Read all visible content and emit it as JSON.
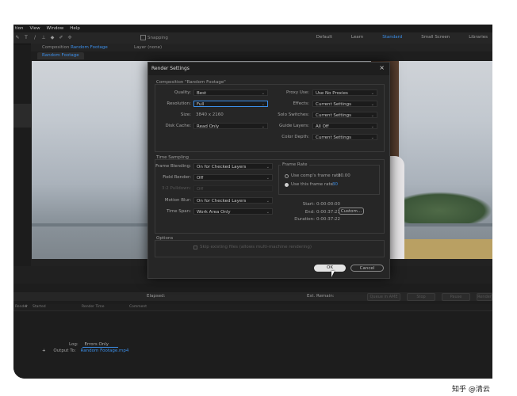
{
  "menubar": {
    "items": [
      "tion",
      "View",
      "Window",
      "Help"
    ]
  },
  "toolbar": {
    "snapping": "Snapping"
  },
  "workspaces": [
    "Default",
    "Learn",
    "Standard",
    "Small Screen",
    "Libraries"
  ],
  "panel": {
    "composition_prefix": "Composition",
    "composition_name": "Random Footage",
    "layer_label": "Layer (none)",
    "tab": "Random Footage"
  },
  "dialog": {
    "title": "Render Settings",
    "composition_group": "Composition \"Random Footage\"",
    "quality": {
      "label": "Quality:",
      "value": "Best"
    },
    "resolution": {
      "label": "Resolution:",
      "value": "Full"
    },
    "size": {
      "label": "Size:",
      "value": "3840 x 2160"
    },
    "disk_cache": {
      "label": "Disk Cache:",
      "value": "Read Only"
    },
    "proxy_use": {
      "label": "Proxy Use:",
      "value": "Use No Proxies"
    },
    "effects": {
      "label": "Effects:",
      "value": "Current Settings"
    },
    "solo_switches": {
      "label": "Solo Switches:",
      "value": "Current Settings"
    },
    "guide_layers": {
      "label": "Guide Layers:",
      "value": "All Off"
    },
    "color_depth": {
      "label": "Color Depth:",
      "value": "Current Settings"
    },
    "time_sampling": "Time Sampling",
    "frame_blending": {
      "label": "Frame Blending:",
      "value": "On for Checked Layers"
    },
    "field_render": {
      "label": "Field Render:",
      "value": "Off"
    },
    "pulldown": {
      "label": "3:2 Pulldown:",
      "value": "Off"
    },
    "motion_blur": {
      "label": "Motion Blur:",
      "value": "On for Checked Layers"
    },
    "time_span": {
      "label": "Time Span:",
      "value": "Work Area Only"
    },
    "frame_rate": {
      "title": "Frame Rate",
      "use_comp": "Use comp's frame rate",
      "comp_rate": "30.00",
      "use_this": "Use this frame rate:",
      "this_rate": "30"
    },
    "start": {
      "label": "Start:",
      "value": "0:00:00:00"
    },
    "end": {
      "label": "End:",
      "value": "0:00:37:21"
    },
    "duration": {
      "label": "Duration:",
      "value": "0:00:37:22"
    },
    "custom_label": "Custom...",
    "options": "Options",
    "options_checkbox": "Skip existing files (allows multi-machine rendering)",
    "ok": "OK",
    "cancel": "Cancel"
  },
  "render_queue": {
    "elapsed": "Elapsed:",
    "est_remain": "Est. Remain:",
    "queue_buttons": [
      "Queue in AME",
      "Stop",
      "Pause",
      "Render"
    ],
    "columns": [
      "Render",
      "#",
      "Started",
      "Render Time",
      "Comment"
    ],
    "log_label": "Log:",
    "log_value": "Errors Only",
    "output_label": "Output To:",
    "output_file": "Random Footage.mp4"
  },
  "watermark": "知乎 @清云"
}
